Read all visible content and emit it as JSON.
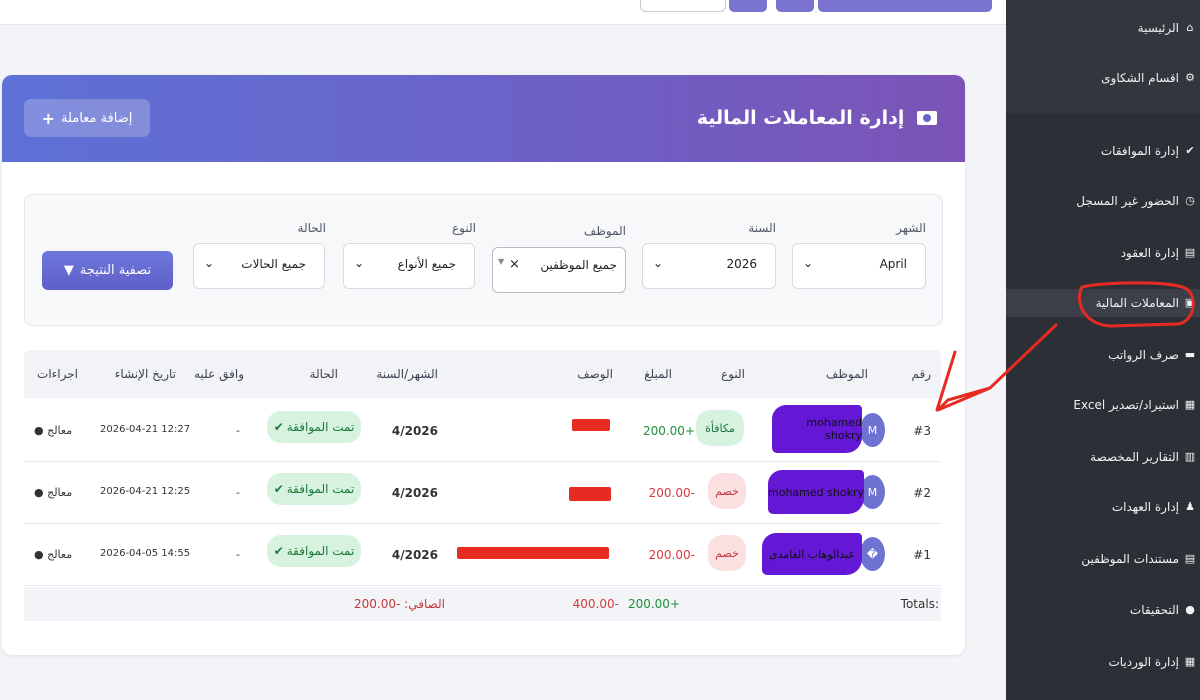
{
  "header": {
    "title": "إدارة المعاملات المالية",
    "add_button": "إضافة معاملة",
    "icon": "money-icon"
  },
  "sidebar": {
    "items": [
      {
        "label": "الرئيسية",
        "icon": "home-icon"
      },
      {
        "label": "اقسام الشكاوى",
        "icon": "sitemap-icon"
      },
      {
        "label": "إدارة الموافقات",
        "icon": "check-circle-icon"
      },
      {
        "label": "الحضور غير المسجل",
        "icon": "clock-icon"
      },
      {
        "label": "إدارة العقود",
        "icon": "file-icon"
      },
      {
        "label": "المعاملات المالية",
        "icon": "money-icon",
        "active": true
      },
      {
        "label": "صرف الرواتب",
        "icon": "wallet-icon"
      },
      {
        "label": "استيراد/تصدير Excel",
        "icon": "excel-icon"
      },
      {
        "label": "التقارير المخصصة",
        "icon": "chart-icon"
      },
      {
        "label": "إدارة العهدات",
        "icon": "users-icon"
      },
      {
        "label": "مستندات الموظفين",
        "icon": "document-icon"
      },
      {
        "label": "التحقيقات",
        "icon": "chat-icon"
      },
      {
        "label": "إدارة الورديات",
        "icon": "calendar-icon"
      }
    ]
  },
  "filters": {
    "month": {
      "label": "الشهر",
      "value": "April"
    },
    "year": {
      "label": "السنة",
      "value": "2026"
    },
    "employee": {
      "label": "الموظف",
      "value": "جميع الموظفين",
      "clear": "×"
    },
    "type": {
      "label": "النوع",
      "value": "جميع الأنواع"
    },
    "status": {
      "label": "الحالة",
      "value": "جميع الحالات"
    },
    "button": "تصفية النتيجة"
  },
  "table": {
    "columns": [
      "رقم",
      "الموظف",
      "النوع",
      "المبلغ",
      "الوصف",
      "الشهر/السنة",
      "الحالة",
      "وافق عليه",
      "تاريخ الإنشاء",
      "اجراءات"
    ],
    "rows": [
      {
        "id": "#3",
        "avatar": "M",
        "employee": "mohamed shokry",
        "type": "مكافأة",
        "type_kind": "bonus",
        "amount": "+200.00",
        "month_year": "4/2026",
        "status": "تمت الموافقة",
        "approved_by": "-",
        "created": "2026-04-21 12:27",
        "action": "معالج"
      },
      {
        "id": "#2",
        "avatar": "M",
        "employee": "mohamed shokry",
        "type": "خصم",
        "type_kind": "deduction",
        "amount": "-200.00",
        "month_year": "4/2026",
        "status": "تمت الموافقة",
        "approved_by": "-",
        "created": "2026-04-21 12:25",
        "action": "معالج"
      },
      {
        "id": "#1",
        "avatar": "�",
        "employee": "عبدالوهاب الغامدي",
        "type": "خصم",
        "type_kind": "deduction",
        "amount": "-200.00",
        "month_year": "4/2026",
        "status": "تمت الموافقة",
        "approved_by": "-",
        "created": "2026-04-05 14:55",
        "action": "معالج"
      }
    ],
    "totals": {
      "label": "Totals:",
      "positive": "+200.00",
      "negative": "-400.00",
      "net": "الصافي: -200.00"
    }
  },
  "colors": {
    "header_gradient_start": "#5d71d6",
    "header_gradient_end": "#7c53b6",
    "sidebar": "#2d2f36",
    "accent": "#6d77da",
    "annotation_red": "#e62b22"
  }
}
